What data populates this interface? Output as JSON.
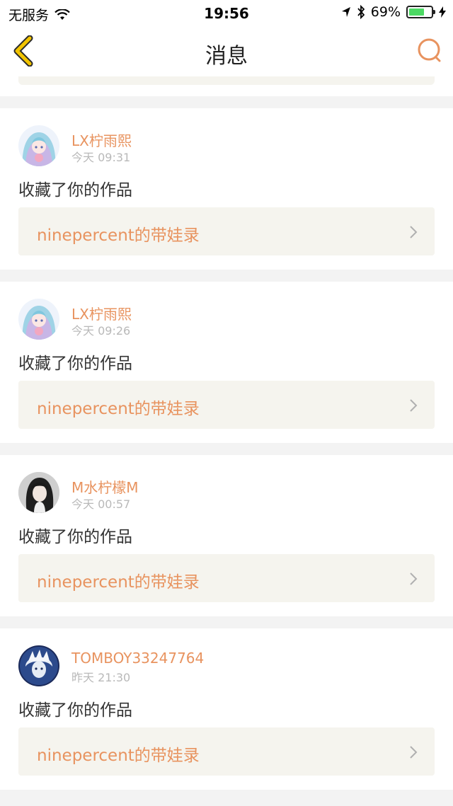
{
  "status_bar": {
    "carrier": "无服务",
    "time": "19:56",
    "battery_percent": "69%",
    "battery_level": 0.69
  },
  "nav": {
    "title": "消息",
    "back_icon": "chevron-left-icon",
    "search_icon": "search-icon"
  },
  "colors": {
    "accent": "#e8935f",
    "card_link_bg": "#f5f4ee",
    "back_chevron": "#f2c400"
  },
  "messages": [
    {
      "username": "LX柠雨熙",
      "time": "今天 09:31",
      "action": "收藏了你的作品",
      "work": "ninepercent的带娃录"
    },
    {
      "username": "LX柠雨熙",
      "time": "今天 09:26",
      "action": "收藏了你的作品",
      "work": "ninepercent的带娃录"
    },
    {
      "username": "M水柠檬M",
      "time": "今天 00:57",
      "action": "收藏了你的作品",
      "work": "ninepercent的带娃录"
    },
    {
      "username": "TOMBOY33247764",
      "time": "昨天 21:30",
      "action": "收藏了你的作品",
      "work": "ninepercent的带娃录"
    }
  ]
}
